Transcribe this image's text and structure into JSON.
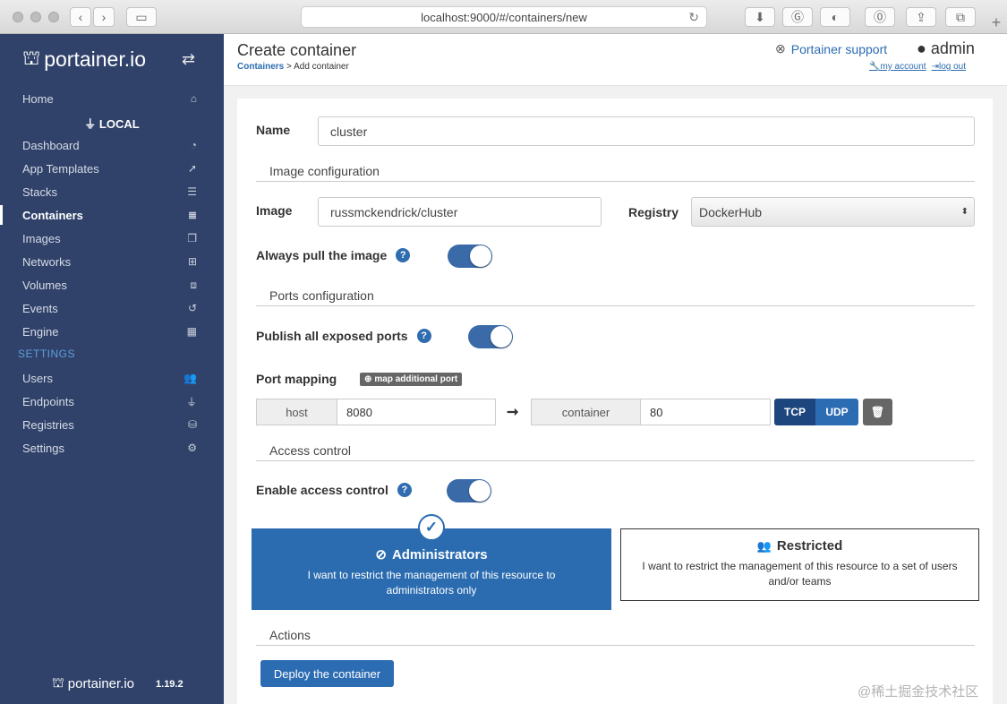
{
  "browser": {
    "url": "localhost:9000/#/containers/new",
    "back_icon": "chevron-left-icon",
    "forward_icon": "chevron-right-icon"
  },
  "sidebar": {
    "logo_text": "portainer.io",
    "endpoint": "LOCAL",
    "items": [
      {
        "label": "Home",
        "icon": "home-icon"
      },
      {
        "label": "Dashboard",
        "icon": "dashboard-icon"
      },
      {
        "label": "App Templates",
        "icon": "rocket-icon"
      },
      {
        "label": "Stacks",
        "icon": "th-list-icon"
      },
      {
        "label": "Containers",
        "icon": "server-icon"
      },
      {
        "label": "Images",
        "icon": "clone-icon"
      },
      {
        "label": "Networks",
        "icon": "sitemap-icon"
      },
      {
        "label": "Volumes",
        "icon": "cubes-icon"
      },
      {
        "label": "Events",
        "icon": "history-icon"
      },
      {
        "label": "Engine",
        "icon": "th-icon"
      }
    ],
    "settings_heading": "SETTINGS",
    "settings_items": [
      {
        "label": "Users",
        "icon": "users-icon"
      },
      {
        "label": "Endpoints",
        "icon": "plug-icon"
      },
      {
        "label": "Registries",
        "icon": "database-icon"
      },
      {
        "label": "Settings",
        "icon": "cogs-icon"
      }
    ],
    "footer_logo": "portainer.io",
    "version": "1.19.2"
  },
  "header": {
    "title": "Create container",
    "breadcrumb_link": "Containers",
    "breadcrumb_sep": ">",
    "breadcrumb_current": "Add container",
    "support": "Portainer support",
    "user": "admin",
    "my_account": "my account",
    "log_out": "log out"
  },
  "form": {
    "name_label": "Name",
    "name_value": "cluster",
    "image_section": "Image configuration",
    "image_label": "Image",
    "image_value": "russmckendrick/cluster",
    "registry_label": "Registry",
    "registry_value": "DockerHub",
    "pull_label": "Always pull the image",
    "ports_section": "Ports configuration",
    "publish_label": "Publish all exposed ports",
    "port_mapping_label": "Port mapping",
    "map_port_button": "map additional port",
    "host_addon": "host",
    "host_value": "8080",
    "container_addon": "container",
    "container_value": "80",
    "tcp": "TCP",
    "udp": "UDP",
    "access_section": "Access control",
    "access_label": "Enable access control",
    "admins_title": "Administrators",
    "admins_desc": "I want to restrict the management of this resource to administrators only",
    "restricted_title": "Restricted",
    "restricted_desc": "I want to restrict the management of this resource to a set of users and/or teams",
    "actions_section": "Actions",
    "deploy_button": "Deploy the container"
  },
  "colors": {
    "sidebar": "#30426a",
    "primary": "#2b6cb0",
    "link": "#2b6cb0"
  },
  "watermark": "@稀土掘金技术社区"
}
